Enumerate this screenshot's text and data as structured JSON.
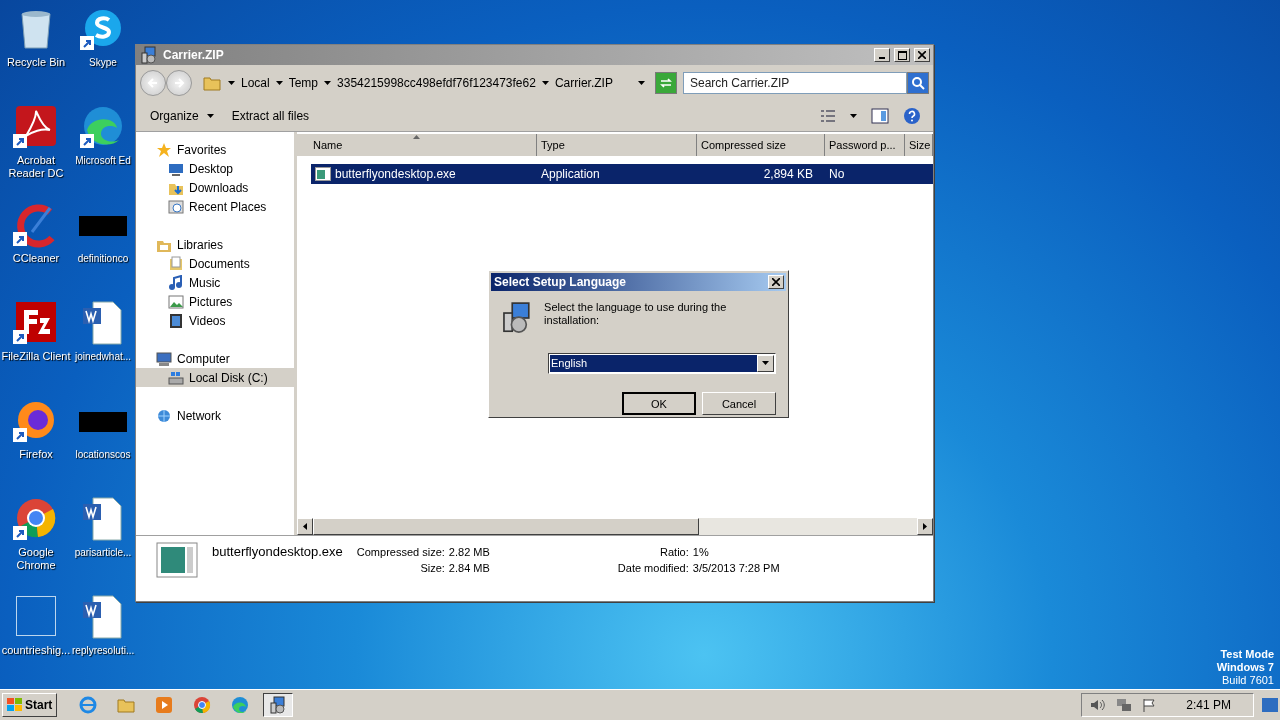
{
  "desktop": {
    "icons": [
      {
        "label": "Recycle Bin",
        "kind": "recycle",
        "shortcut": false
      },
      {
        "label": "Acrobat Reader DC",
        "kind": "acrobat",
        "shortcut": true
      },
      {
        "label": "CCleaner",
        "kind": "ccleaner",
        "shortcut": true
      },
      {
        "label": "FileZilla Client",
        "kind": "filezilla",
        "shortcut": true
      },
      {
        "label": "Firefox",
        "kind": "firefox",
        "shortcut": true
      },
      {
        "label": "Google Chrome",
        "kind": "chrome",
        "shortcut": true
      },
      {
        "label": "countrieshig...",
        "kind": "blank",
        "shortcut": false
      },
      {
        "label": "Skype",
        "kind": "skype",
        "shortcut": true
      },
      {
        "label": "Microsoft Ed",
        "kind": "edge",
        "shortcut": true
      },
      {
        "label": "definitionco",
        "kind": "black",
        "shortcut": false
      },
      {
        "label": "joinedwhat...",
        "kind": "word",
        "shortcut": false
      },
      {
        "label": "locationscos",
        "kind": "black",
        "shortcut": false
      },
      {
        "label": "parisarticle...",
        "kind": "word",
        "shortcut": false
      },
      {
        "label": "replyresoluti...",
        "kind": "word",
        "shortcut": false
      }
    ],
    "os_notice": [
      "Test Mode",
      "Windows 7",
      "Build 7601"
    ]
  },
  "explorer": {
    "title": "Carrier.ZIP",
    "breadcrumb": [
      "Local",
      "Temp",
      "3354215998cc498efdf76f123473fe62",
      "Carrier.ZIP"
    ],
    "search": {
      "placeholder": "Search Carrier.ZIP"
    },
    "toolbar": [
      {
        "label": "Organize",
        "dropdown": true
      },
      {
        "label": "Extract all files",
        "dropdown": false
      }
    ],
    "nav": [
      {
        "label": "Favorites",
        "kind": "star",
        "selected": false,
        "children": [
          {
            "label": "Desktop",
            "kind": "desktop",
            "selected": false
          },
          {
            "label": "Downloads",
            "kind": "downloads",
            "selected": false
          },
          {
            "label": "Recent Places",
            "kind": "recent",
            "selected": false
          }
        ]
      },
      {
        "label": "Libraries",
        "kind": "library",
        "selected": false,
        "children": [
          {
            "label": "Documents",
            "kind": "documents",
            "selected": false
          },
          {
            "label": "Music",
            "kind": "music",
            "selected": false
          },
          {
            "label": "Pictures",
            "kind": "pictures",
            "selected": false
          },
          {
            "label": "Videos",
            "kind": "videos",
            "selected": false
          }
        ]
      },
      {
        "label": "Computer",
        "kind": "computer",
        "selected": false,
        "children": [
          {
            "label": "Local Disk (C:)",
            "kind": "disk",
            "selected": true
          }
        ]
      },
      {
        "label": "Network",
        "kind": "network",
        "selected": false
      }
    ],
    "columns": [
      {
        "label": "Name",
        "sorted": true
      },
      {
        "label": "Type",
        "sorted": false
      },
      {
        "label": "Compressed size",
        "sorted": false
      },
      {
        "label": "Password p...",
        "sorted": false
      },
      {
        "label": "Size",
        "sorted": false
      }
    ],
    "rows": [
      {
        "name": "butterflyondesktop.exe",
        "type": "Application",
        "compressed": "2,894 KB",
        "password": "No",
        "selected": true
      }
    ],
    "details": {
      "filename": "butterflyondesktop.exe",
      "fields": [
        {
          "label": "Compressed size:",
          "value": "2.82 MB"
        },
        {
          "label": "Ratio:",
          "value": "1%"
        },
        {
          "label": "Size:",
          "value": "2.84 MB"
        },
        {
          "label": "Date modified:",
          "value": "3/5/2013 7:28 PM"
        }
      ]
    }
  },
  "dialog": {
    "title": "Select Setup Language",
    "message": "Select the language to use during the installation:",
    "language": "English",
    "buttons": [
      {
        "label": "OK",
        "default": true
      },
      {
        "label": "Cancel",
        "default": false
      }
    ]
  },
  "taskbar": {
    "start": "Start",
    "apps": [
      {
        "kind": "ie",
        "active": false
      },
      {
        "kind": "explorer",
        "active": false
      },
      {
        "kind": "media",
        "active": false
      },
      {
        "kind": "chrome",
        "active": false
      },
      {
        "kind": "edge",
        "active": false
      },
      {
        "kind": "setup",
        "active": true
      }
    ],
    "clock": "2:41 PM"
  }
}
